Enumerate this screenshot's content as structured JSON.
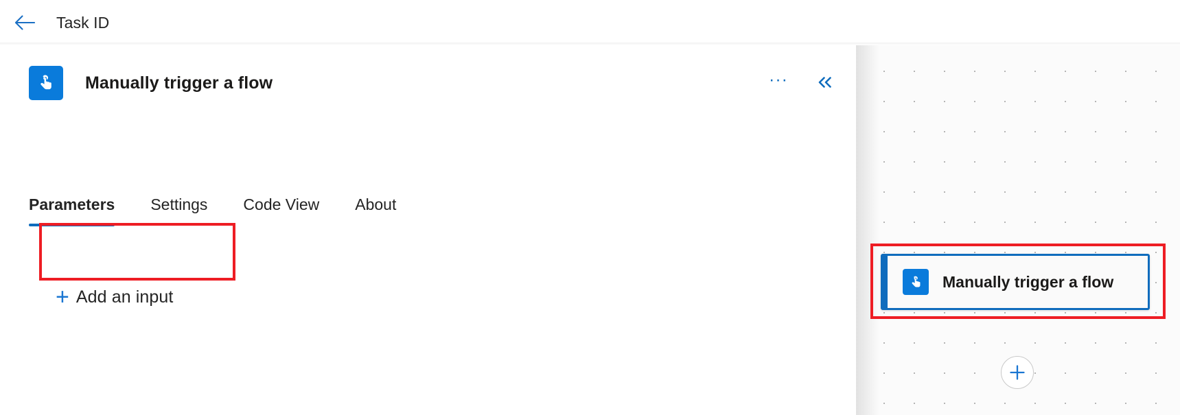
{
  "topbar": {
    "back_icon": "arrow-left-icon",
    "title": "Task ID"
  },
  "details_panel": {
    "icon": "manual-trigger-tap-icon",
    "title": "Manually trigger a flow",
    "more_options_label": "···",
    "more_options_icon": "ellipsis-icon",
    "collapse_label": "«",
    "collapse_icon": "chevron-double-left-icon",
    "tabs": [
      {
        "label": "Parameters",
        "active": true
      },
      {
        "label": "Settings",
        "active": false
      },
      {
        "label": "Code View",
        "active": false
      },
      {
        "label": "About",
        "active": false
      }
    ],
    "add_input": {
      "plus": "+",
      "plus_icon": "plus-icon",
      "label": "Add an input"
    }
  },
  "canvas": {
    "node": {
      "icon": "manual-trigger-tap-icon",
      "label": "Manually trigger a flow",
      "selected": true
    },
    "add_step": {
      "icon": "plus-circle-icon"
    }
  },
  "annotations": {
    "color": "#ee1d24",
    "boxes": [
      {
        "name": "add-input-highlight"
      },
      {
        "name": "trigger-node-highlight"
      }
    ]
  },
  "colors": {
    "accent_blue": "#0f6cbd",
    "icon_blue": "#0a7bdb",
    "annotation_red": "#ee1d24",
    "text": "#242424",
    "canvas_bg": "#fbfbfb"
  }
}
